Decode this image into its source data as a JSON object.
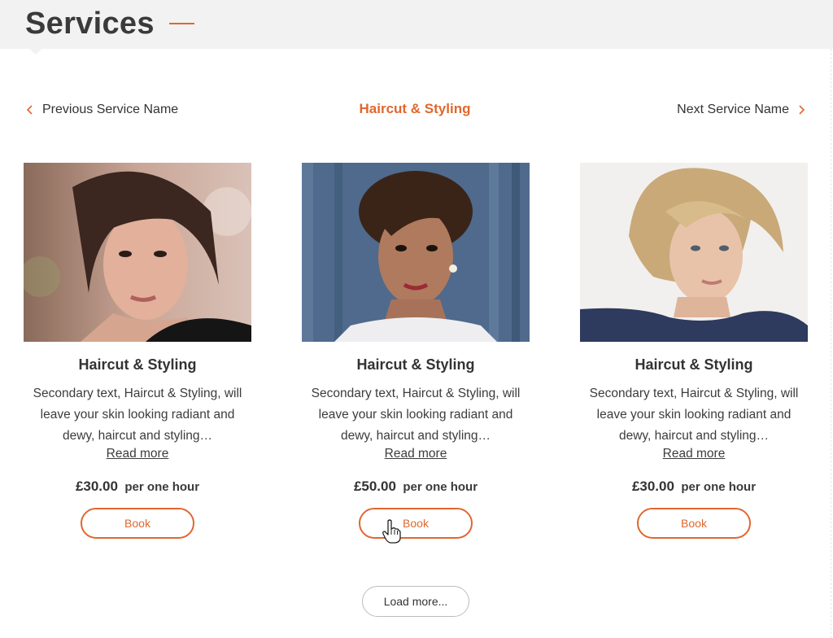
{
  "header": {
    "title": "Services"
  },
  "nav": {
    "previous_label": "Previous Service Name",
    "current_label": "Haircut & Styling",
    "next_label": "Next Service Name",
    "chevron_left_icon": "chevron-left-icon",
    "chevron_right_icon": "chevron-right-icon"
  },
  "colors": {
    "accent": "#e0672f",
    "header_bg": "#f2f2f2",
    "text": "#333333"
  },
  "cards": [
    {
      "title": "Haircut & Styling",
      "description": "Secondary text, Haircut & Styling, will leave your skin looking radiant and dewy, haircut and styling…",
      "read_more": "Read more",
      "price": "£30.00",
      "per": "per one hour",
      "book_label": "Book"
    },
    {
      "title": "Haircut & Styling",
      "description": "Secondary text, Haircut & Styling, will leave your skin looking radiant and dewy, haircut and styling…",
      "read_more": "Read more",
      "price": "£50.00",
      "per": "per one hour",
      "book_label": "Book"
    },
    {
      "title": "Haircut & Styling",
      "description": "Secondary text, Haircut & Styling, will leave your skin looking radiant and dewy, haircut and styling…",
      "read_more": "Read more",
      "price": "£30.00",
      "per": "per one hour",
      "book_label": "Book"
    }
  ],
  "load_more_label": "Load more..."
}
